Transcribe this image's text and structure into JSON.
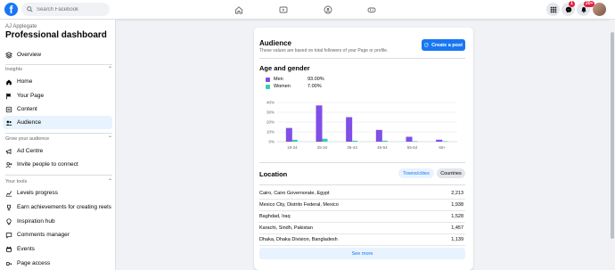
{
  "topbar": {
    "logo_letter": "f",
    "search_placeholder": "Search Facebook",
    "nav_icons": [
      "home-icon",
      "video-icon",
      "groups-icon",
      "gaming-icon"
    ],
    "right_icons": [
      "menu-grid-icon",
      "messenger-icon",
      "bell-icon"
    ],
    "messenger_badge": "1",
    "notifications_badge": "20+"
  },
  "sidebar": {
    "owner": "AJ Applegate",
    "title": "Professional dashboard",
    "overview": "Overview",
    "insights_heading": "Insights",
    "insights_items": [
      "Home",
      "Your Page",
      "Content",
      "Audience"
    ],
    "grow_heading": "Grow your audience",
    "grow_items": [
      "Ad Centre",
      "Invite people to connect"
    ],
    "tools_heading": "Your tools",
    "tools_items": [
      "Levels progress",
      "Earn achievements for creating reels",
      "Inspiration hub",
      "Comments manager",
      "Events",
      "Page access"
    ]
  },
  "audience": {
    "title": "Audience",
    "subtitle": "These values are based on total followers of your Page or profile.",
    "create_post": "Create a post"
  },
  "age_gender": {
    "title": "Age and gender",
    "legend": [
      {
        "label": "Men",
        "pct": "93.00%",
        "color": "#7f4fe6"
      },
      {
        "label": "Women",
        "pct": "7.00%",
        "color": "#3ccbb4"
      }
    ]
  },
  "chart_data": {
    "type": "bar",
    "categories": [
      "18-24",
      "25-34",
      "35-44",
      "45-54",
      "55-64",
      "65+"
    ],
    "series": [
      {
        "name": "Men",
        "values": [
          14,
          37,
          25,
          12,
          5,
          2
        ],
        "color": "#7f4fe6"
      },
      {
        "name": "Women",
        "values": [
          2,
          3,
          1,
          1,
          0.5,
          0.5
        ],
        "color": "#3ccbb4"
      }
    ],
    "y_ticks": [
      "0%",
      "10%",
      "20%",
      "30%",
      "40%"
    ],
    "ylim": [
      0,
      40
    ],
    "grid": true
  },
  "location": {
    "title": "Location",
    "tab_towns": "Towns/cities",
    "tab_countries": "Countries",
    "rows": [
      {
        "place": "Cairo, Cairo Governorate, Egypt",
        "count": "2,213"
      },
      {
        "place": "Mexico City, Distrito Federal, Mexico",
        "count": "1,938"
      },
      {
        "place": "Baghdad, Iraq",
        "count": "1,528"
      },
      {
        "place": "Karachi, Sindh, Pakistan",
        "count": "1,457"
      },
      {
        "place": "Dhaka, Dhaka Division, Bangladesh",
        "count": "1,139"
      }
    ],
    "see_more": "See more"
  }
}
